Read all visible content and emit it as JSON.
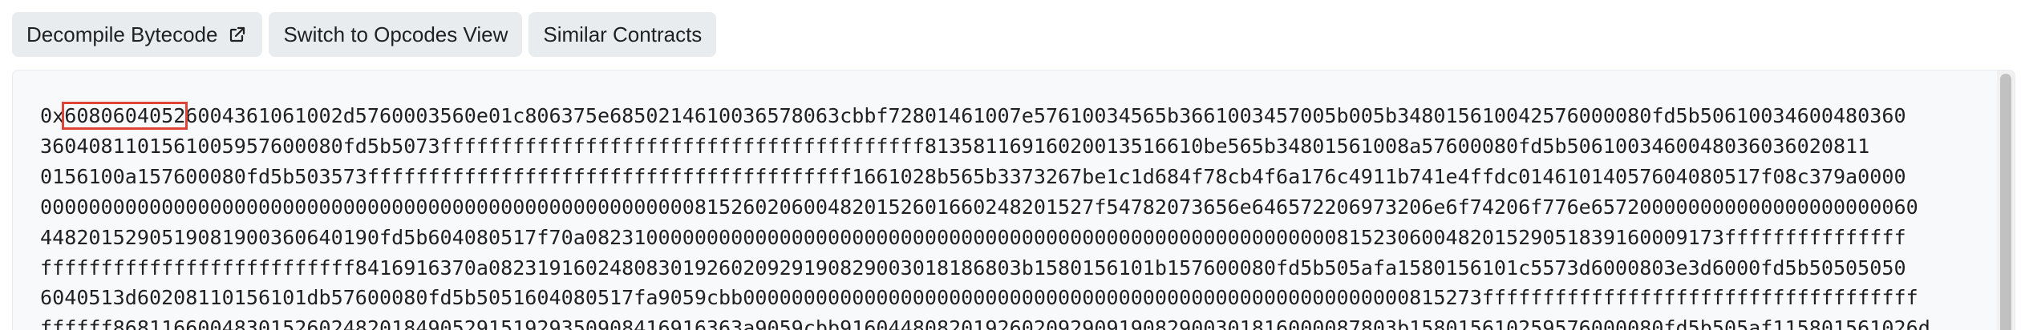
{
  "toolbar": {
    "decompile_label": "Decompile Bytecode",
    "decompile_icon": "external-link-icon",
    "opcodes_label": "Switch to Opcodes View",
    "similar_label": "Similar Contracts"
  },
  "bytecode": {
    "prefix": "0x",
    "highlight": "6080604052",
    "rest": "6004361061002d5760003560e01c806375e6850214610036578063cbbf72801461007e57610034565b3661003457005b005b348015610042576000080fd5b50610034600480360\n3604081101561005957600080fd5b5073ffffffffffffffffffffffffffffffffffffffff81358116916020013516610be565b34801561008a57600080fd5b5061003460048036036020811\n0156100a157600080fd5b503573ffffffffffffffffffffffffffffffffffffffff1661028b565b3373267be1c1d684f78cb4f6a176c4911b741e4ffdc0146101405760408051 7f08c379a0000\n00000000000000000000000000000000000000000000000000000081526020600482015260166024820152 7f54782073656e646572206973206e6f74206f776e657200000000000000000000060\n448201529051908190036064019 0fd5b604080517f70a0823100000000000000000000000000000000000000000000000000000000081523060048201529051839160009173fffffffffffffff\nffffffffffffffffffffffffff8416916370a08231916024808301926020929190829003018186803b1580156101b157600080fd5b505afa1580156101c5573d6000803e3d6000fd5b50505050\n6040513d60208110156101db57600080fd5b505160408051 7fa9059cbb0000000000000000000000000000000000000000000000000000000815273ffffffffffffffffffffffffffffffffffff\nffffff868116600483015260248201849052915192935090841691636 3a9059cbb9160448082019260209290919082900301816000087803b158015610259576000080fd5b505af11580156102 6d"
  },
  "colors": {
    "button_bg": "#e9ecef",
    "panel_bg": "#f8f9fa",
    "highlight_border": "#de4437",
    "text": "#1e2022"
  }
}
